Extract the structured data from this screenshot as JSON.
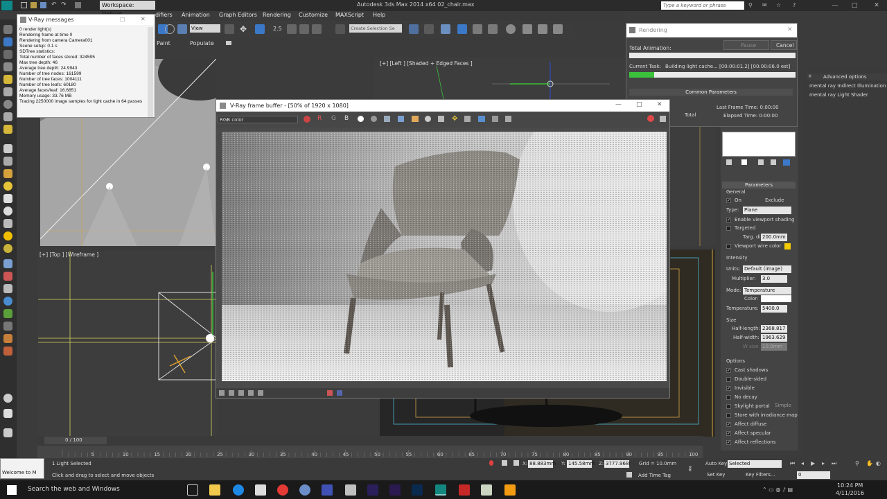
{
  "app": {
    "title": "Autodesk 3ds Max  2014 x64     02_chair.max",
    "workspace": "Workspace: Default",
    "search_placeholder": "Type a keyword or phrase"
  },
  "menubar": [
    "difiers",
    "Animation",
    "Graph Editors",
    "Rendering",
    "Customize",
    "MAXScript",
    "Help"
  ],
  "toolbar": {
    "view_dropdown": "View",
    "selection_set": "Create Selection Se"
  },
  "command_tabs": [
    "Paint",
    "Populate"
  ],
  "viewports": {
    "left_label": "[+] [Left ] [Shaded + Edged Faces ]",
    "top_label": "[+] [Top ] [Wireframe ]"
  },
  "vray_messages": {
    "title": "V-Ray messages",
    "lines": [
      "0 render light(s)",
      "Rendering frame at time 0",
      "Rendering from camera Camera001",
      "Scene setup: 0.1 s",
      "SDTree statistics:",
      "Total number of faces stored: 324595",
      "Max tree depth: 46",
      "Average tree depth: 24.9943",
      "Number of tree nodes: 161599",
      "Number of tree faces: 1004111",
      "Number of tree leafs: 60180",
      "Average faces/leaf: 16.6851",
      "Memory usage: 33.76 MB",
      "Tracing 2250000 image samples for light cache in 64 passes"
    ]
  },
  "render_dialog": {
    "title": "Rendering",
    "total_animation": "Total Animation:",
    "pause": "Pause",
    "cancel": "Cancel",
    "current_task_label": "Current Task:",
    "current_task": "Building light cache... [00:00:01.2] [00:00:06.0 est]",
    "progress": 0.15,
    "common_parameters": "Common Parameters",
    "total": "Total",
    "last_frame_time": "Last Frame Time: 0:00:00",
    "elapsed_time": "Elapsed Time: 0:00:00"
  },
  "vfb": {
    "title": "V-Ray frame buffer - [50% of 1920 x 1080]",
    "channel": "RGB color"
  },
  "right_strip": {
    "advanced_options": "Advanced options",
    "items": [
      "mental ray Indirect Illumination",
      "mental ray Light Shader"
    ]
  },
  "parameters": {
    "header": "Parameters",
    "general": "General",
    "on": "On",
    "exclude": "Exclude",
    "type_label": "Type:",
    "type": "Plane",
    "enable_viewport_shading": "Enable viewport shading",
    "targeted": "Targeted",
    "targ_dist_label": "Targ. dist:",
    "targ_dist": "200.0mm",
    "viewport_wire_color": "Viewport wire color",
    "intensity": "Intensity",
    "units_label": "Units:",
    "units": "Default (image)",
    "multiplier_label": "Multiplier:",
    "multiplier": "3.0",
    "mode_label": "Mode:",
    "mode": "Temperature",
    "color_label": "Color:",
    "temperature_label": "Temperature:",
    "temperature": "5400.0",
    "size": "Size",
    "half_length_label": "Half-length:",
    "half_length": "2368.817",
    "half_width_label": "Half-width:",
    "half_width": "1963.629",
    "w_size_label": "W size",
    "w_size": "10.0mm",
    "options": "Options",
    "opts": [
      {
        "label": "Cast shadows",
        "checked": true
      },
      {
        "label": "Double-sided",
        "checked": false
      },
      {
        "label": "Invisible",
        "checked": true
      },
      {
        "label": "No decay",
        "checked": false
      },
      {
        "label": "Skylight portal",
        "checked": false
      },
      {
        "label": "Store with irradiance map",
        "checked": false
      },
      {
        "label": "Affect diffuse",
        "checked": true
      },
      {
        "label": "Affect specular",
        "checked": true
      },
      {
        "label": "Affect reflections",
        "checked": true
      }
    ],
    "simple": "Simple"
  },
  "timeline": {
    "frame": "0 / 100",
    "ticks": [
      "5",
      "10",
      "15",
      "20",
      "25",
      "30",
      "35",
      "40",
      "45",
      "50",
      "55",
      "60",
      "65",
      "70",
      "75",
      "80",
      "85",
      "90",
      "95",
      "100"
    ]
  },
  "status": {
    "welcome": "Welcome to M",
    "selected": "1 Light Selected",
    "hint": "Click and drag to select and move objects",
    "x": "88.883mm",
    "y": "145.58mm",
    "z": "3777.968r",
    "grid": "Grid = 10.0mm",
    "add_time_tag": "Add Time Tag",
    "auto_key": "Auto Key",
    "set_key": "Set Key",
    "selected_dropdown": "Selected",
    "key_filters": "Key Filters...",
    "frame_field": "0"
  },
  "taskbar": {
    "search": "Search the web and Windows",
    "time": "10:24 PM",
    "date": "4/11/2016"
  }
}
